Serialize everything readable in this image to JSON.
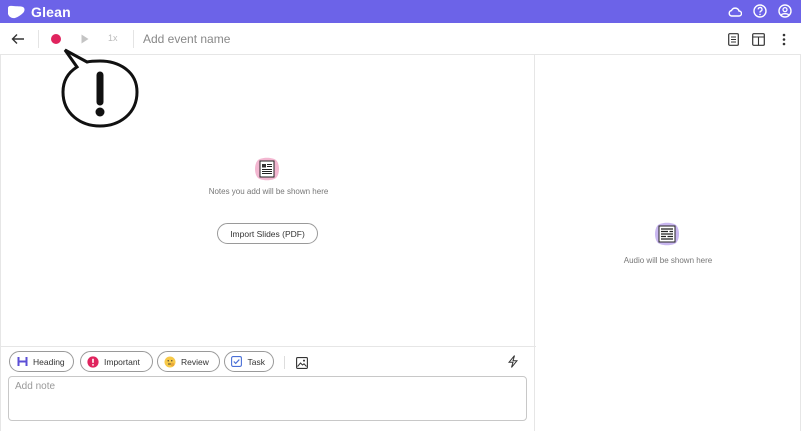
{
  "app": {
    "name": "Glean"
  },
  "colors": {
    "brand": "#6c63e8",
    "record": "#e0245e",
    "heading_icon": "#5b4fd6",
    "important_icon": "#e0245e"
  },
  "titlebar_icons": [
    "cloud-icon",
    "help-icon",
    "account-icon"
  ],
  "toolbar": {
    "speed": "1x",
    "event_name_placeholder": "Add event name",
    "right_icons": [
      "notes-view-icon",
      "layout-icon",
      "more-menu-icon"
    ]
  },
  "notes_pane": {
    "empty_text": "Notes you add will be shown here",
    "import_label": "Import Slides (PDF)"
  },
  "audio_pane": {
    "empty_text": "Audio will be shown here"
  },
  "note_toolbar": {
    "chips": [
      {
        "label": "Heading",
        "icon": "heading-icon"
      },
      {
        "label": "Important",
        "icon": "important-icon"
      },
      {
        "label": "Review",
        "icon": "review-icon"
      },
      {
        "label": "Task",
        "icon": "task-icon"
      }
    ]
  },
  "note_input": {
    "placeholder": "Add note"
  }
}
